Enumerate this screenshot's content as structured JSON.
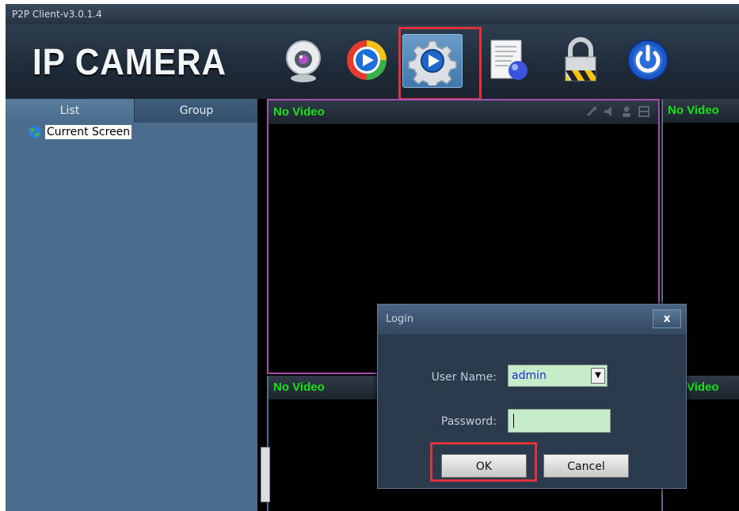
{
  "window": {
    "title": "P2P Client-v3.0.1.4"
  },
  "toolbar": {
    "logo_text": "IP CAMERA",
    "buttons": [
      {
        "icon": "webcam-icon"
      },
      {
        "icon": "playback-icon"
      },
      {
        "icon": "settings-icon",
        "selected": true
      },
      {
        "icon": "log-icon"
      },
      {
        "icon": "lock-icon"
      },
      {
        "icon": "power-icon"
      }
    ]
  },
  "sidebar": {
    "tabs": [
      {
        "label": "List",
        "active": true
      },
      {
        "label": "Group",
        "active": false
      }
    ],
    "tree": [
      {
        "label": "Current Screen",
        "icon": "globe-icon"
      }
    ]
  },
  "video": {
    "panes": [
      {
        "title": "No Video",
        "selected": true
      },
      {
        "title": "No Video"
      },
      {
        "title": "No Video"
      },
      {
        "title": "Video"
      }
    ],
    "pane_icons": [
      "snapshot-icon",
      "audio-icon",
      "talk-icon",
      "record-icon"
    ]
  },
  "login_dialog": {
    "title": "Login",
    "close_label": "x",
    "user_name_label": "User Name:",
    "user_name_value": "admin",
    "password_label": "Password:",
    "password_value": "",
    "ok_label": "OK",
    "cancel_label": "Cancel"
  },
  "colors": {
    "accent_highlight": "#e0323a",
    "video_title": "#19e019",
    "selected_pane_border": "#a44fb0",
    "input_background": "#c7ecca"
  }
}
